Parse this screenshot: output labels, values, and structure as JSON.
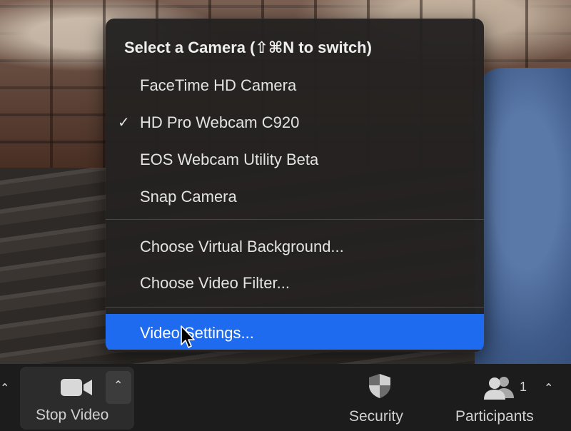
{
  "menu": {
    "title": "Select a Camera (⇧⌘N to switch)",
    "cameras": [
      {
        "label": "FaceTime HD Camera",
        "checked": false
      },
      {
        "label": "HD Pro Webcam C920",
        "checked": true
      },
      {
        "label": "EOS Webcam Utility Beta",
        "checked": false
      },
      {
        "label": "Snap Camera",
        "checked": false
      }
    ],
    "options": [
      {
        "label": "Choose Virtual Background..."
      },
      {
        "label": "Choose Video Filter..."
      }
    ],
    "settings": {
      "label": "Video Settings..."
    },
    "check_glyph": "✓",
    "highlight_color": "#1f6bf0"
  },
  "toolbar": {
    "stop_video_label": "Stop Video",
    "security_label": "Security",
    "participants_label": "Participants",
    "participants_count": "1",
    "caret_glyph": "⌃"
  },
  "icons": [
    "video-camera-icon",
    "shield-icon",
    "participants-icon",
    "chevron-up-icon",
    "checkmark-icon",
    "cursor-icon"
  ]
}
